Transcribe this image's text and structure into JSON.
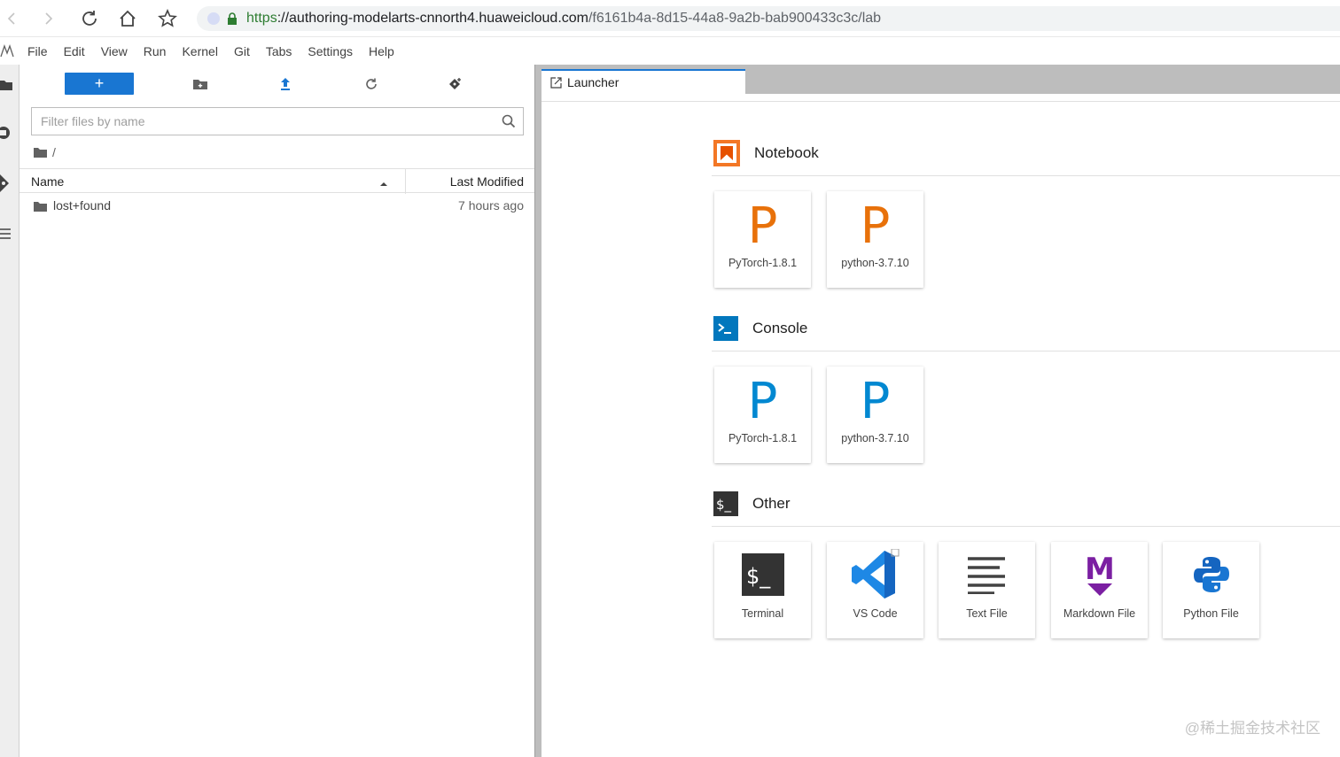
{
  "browser": {
    "url_scheme": "https",
    "url_host": "://authoring-modelarts-cnnorth4.huaweicloud.com",
    "url_path": "/f6161b4a-8d15-44a8-9a2b-bab900433c3c/lab"
  },
  "menu": {
    "items": [
      "File",
      "Edit",
      "View",
      "Run",
      "Kernel",
      "Git",
      "Tabs",
      "Settings",
      "Help"
    ]
  },
  "file_browser": {
    "new_label": "+",
    "filter_placeholder": "Filter files by name",
    "breadcrumb": "/",
    "columns": {
      "name": "Name",
      "modified": "Last Modified"
    },
    "rows": [
      {
        "name": "lost+found",
        "modified": "7 hours ago"
      }
    ]
  },
  "launcher": {
    "tab_label": "Launcher",
    "sections": {
      "notebook": {
        "title": "Notebook",
        "cards": [
          "PyTorch-1.8.1",
          "python-3.7.10"
        ],
        "glyph": "P"
      },
      "console": {
        "title": "Console",
        "cards": [
          "PyTorch-1.8.1",
          "python-3.7.10"
        ],
        "glyph": "P"
      },
      "other": {
        "title": "Other",
        "cards": [
          "Terminal",
          "VS Code",
          "Text File",
          "Markdown File",
          "Python File"
        ]
      }
    }
  },
  "watermark": "@稀土掘金技术社区",
  "colors": {
    "accent_blue": "#1976d2",
    "notebook_orange": "#f37726",
    "console_blue": "#0288d1",
    "markdown_purple": "#7b1fa2"
  }
}
